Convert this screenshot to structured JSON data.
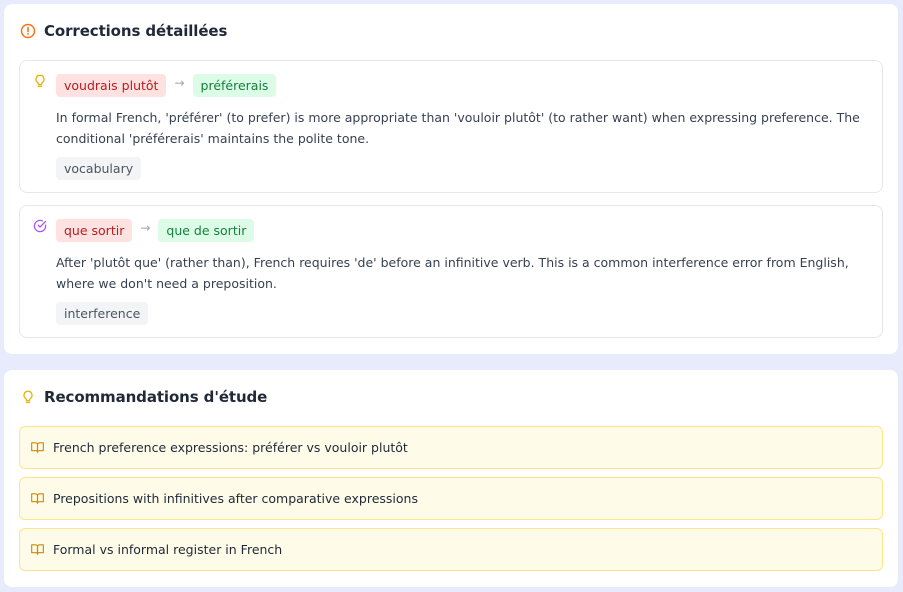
{
  "corrections": {
    "title": "Corrections détaillées",
    "items": [
      {
        "original": "voudrais plutôt",
        "arrow": "→",
        "corrected": "préférerais",
        "explanation": "In formal French, 'préférer' (to prefer) is more appropriate than 'vouloir plutôt' (to rather want) when expressing preference. The conditional 'préférerais' maintains the polite tone.",
        "tag": "vocabulary",
        "icon": "lightbulb-icon"
      },
      {
        "original": "que sortir",
        "arrow": "→",
        "corrected": "que de sortir",
        "explanation": "After 'plutôt que' (rather than), French requires 'de' before an infinitive verb. This is a common interference error from English, where we don't need a preposition.",
        "tag": "interference",
        "icon": "check-circle-icon"
      }
    ]
  },
  "recommendations": {
    "title": "Recommandations d'étude",
    "items": [
      {
        "label": "French preference expressions: préférer vs vouloir plutôt",
        "icon": "book-icon"
      },
      {
        "label": "Prepositions with infinitives after comparative expressions",
        "icon": "book-icon"
      },
      {
        "label": "Formal vs informal register in French",
        "icon": "book-icon"
      }
    ]
  },
  "colors": {
    "page_background": "#e8ebfb",
    "alert_icon": "#f97316",
    "lightbulb_icon": "#eab308",
    "check_icon": "#a855f7",
    "wrong_chip_bg": "#fee2e2",
    "wrong_chip_text": "#b91c1c",
    "right_chip_bg": "#dcfce7",
    "right_chip_text": "#15803d",
    "reco_bg": "#fefce8",
    "reco_border": "#fde68a",
    "book_icon": "#ca8a04"
  }
}
